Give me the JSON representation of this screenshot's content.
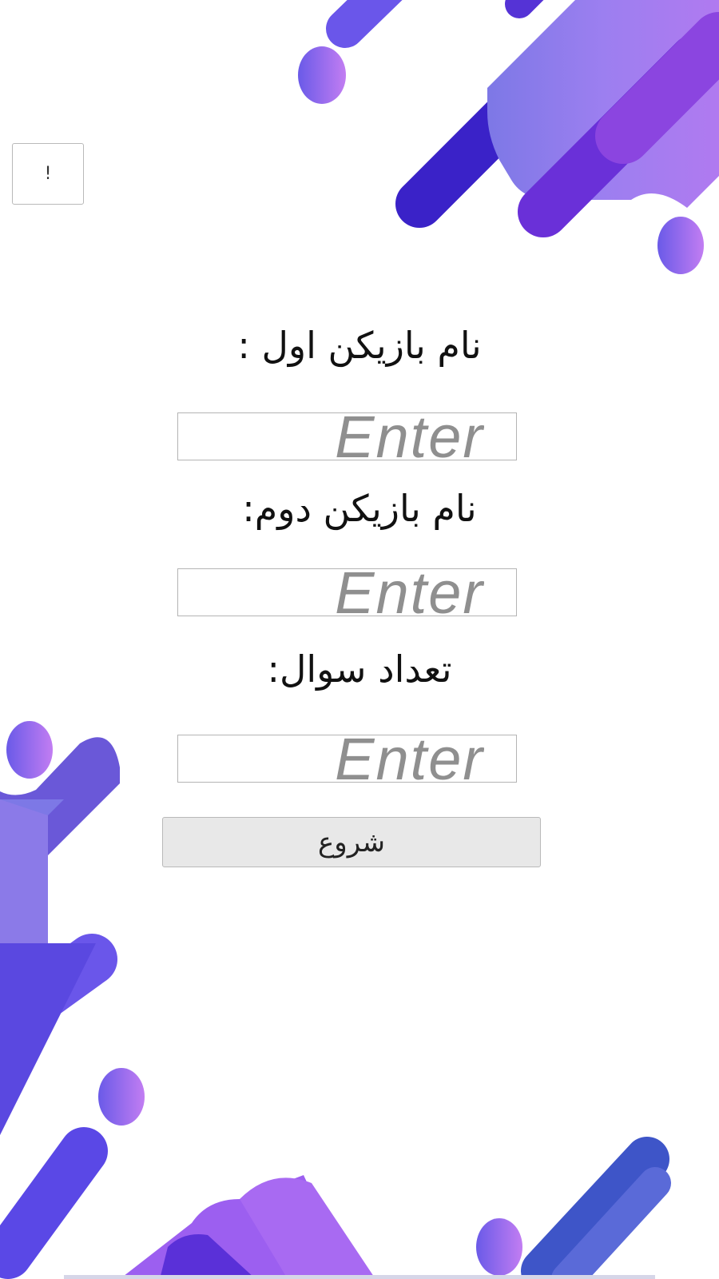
{
  "info_button": {
    "label": "!"
  },
  "form": {
    "player1": {
      "label": "نام بازیکن اول :",
      "placeholder": "Enter"
    },
    "player2": {
      "label": "نام بازیکن دوم:",
      "placeholder": "Enter"
    },
    "question_count": {
      "label": "تعداد سوال:",
      "placeholder": "Enter"
    },
    "start_label": "شروع"
  },
  "colors": {
    "background": "#ffffff",
    "purple_dark": "#3a22c8",
    "purple_mid": "#6a50e8",
    "violet": "#8b45e0",
    "lavender": "#b07af0",
    "button_bg": "#e8e8e8",
    "placeholder": "#8f8f8f"
  }
}
